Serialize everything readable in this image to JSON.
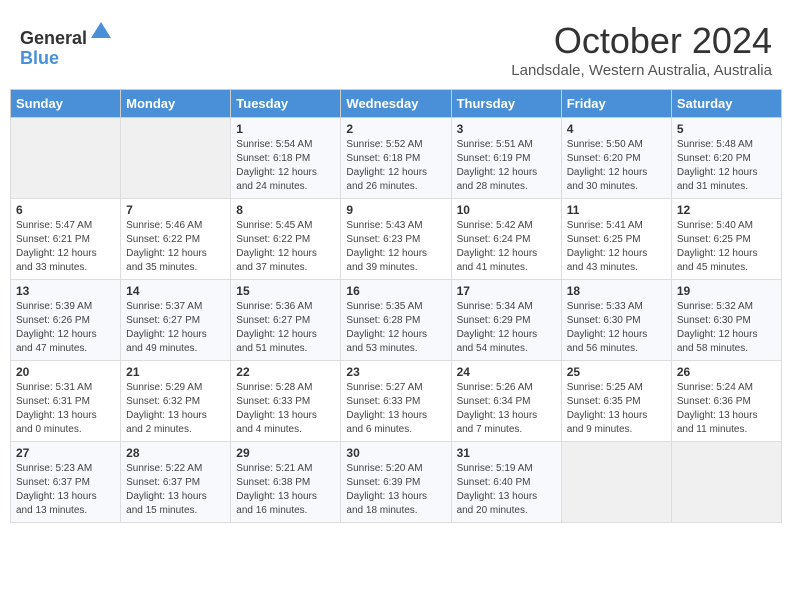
{
  "header": {
    "logo_line1": "General",
    "logo_line2": "Blue",
    "title": "October 2024",
    "subtitle": "Landsdale, Western Australia, Australia"
  },
  "days_of_week": [
    "Sunday",
    "Monday",
    "Tuesday",
    "Wednesday",
    "Thursday",
    "Friday",
    "Saturday"
  ],
  "weeks": [
    [
      {
        "day": "",
        "info": ""
      },
      {
        "day": "",
        "info": ""
      },
      {
        "day": "1",
        "info": "Sunrise: 5:54 AM\nSunset: 6:18 PM\nDaylight: 12 hours and 24 minutes."
      },
      {
        "day": "2",
        "info": "Sunrise: 5:52 AM\nSunset: 6:18 PM\nDaylight: 12 hours and 26 minutes."
      },
      {
        "day": "3",
        "info": "Sunrise: 5:51 AM\nSunset: 6:19 PM\nDaylight: 12 hours and 28 minutes."
      },
      {
        "day": "4",
        "info": "Sunrise: 5:50 AM\nSunset: 6:20 PM\nDaylight: 12 hours and 30 minutes."
      },
      {
        "day": "5",
        "info": "Sunrise: 5:48 AM\nSunset: 6:20 PM\nDaylight: 12 hours and 31 minutes."
      }
    ],
    [
      {
        "day": "6",
        "info": "Sunrise: 5:47 AM\nSunset: 6:21 PM\nDaylight: 12 hours and 33 minutes."
      },
      {
        "day": "7",
        "info": "Sunrise: 5:46 AM\nSunset: 6:22 PM\nDaylight: 12 hours and 35 minutes."
      },
      {
        "day": "8",
        "info": "Sunrise: 5:45 AM\nSunset: 6:22 PM\nDaylight: 12 hours and 37 minutes."
      },
      {
        "day": "9",
        "info": "Sunrise: 5:43 AM\nSunset: 6:23 PM\nDaylight: 12 hours and 39 minutes."
      },
      {
        "day": "10",
        "info": "Sunrise: 5:42 AM\nSunset: 6:24 PM\nDaylight: 12 hours and 41 minutes."
      },
      {
        "day": "11",
        "info": "Sunrise: 5:41 AM\nSunset: 6:25 PM\nDaylight: 12 hours and 43 minutes."
      },
      {
        "day": "12",
        "info": "Sunrise: 5:40 AM\nSunset: 6:25 PM\nDaylight: 12 hours and 45 minutes."
      }
    ],
    [
      {
        "day": "13",
        "info": "Sunrise: 5:39 AM\nSunset: 6:26 PM\nDaylight: 12 hours and 47 minutes."
      },
      {
        "day": "14",
        "info": "Sunrise: 5:37 AM\nSunset: 6:27 PM\nDaylight: 12 hours and 49 minutes."
      },
      {
        "day": "15",
        "info": "Sunrise: 5:36 AM\nSunset: 6:27 PM\nDaylight: 12 hours and 51 minutes."
      },
      {
        "day": "16",
        "info": "Sunrise: 5:35 AM\nSunset: 6:28 PM\nDaylight: 12 hours and 53 minutes."
      },
      {
        "day": "17",
        "info": "Sunrise: 5:34 AM\nSunset: 6:29 PM\nDaylight: 12 hours and 54 minutes."
      },
      {
        "day": "18",
        "info": "Sunrise: 5:33 AM\nSunset: 6:30 PM\nDaylight: 12 hours and 56 minutes."
      },
      {
        "day": "19",
        "info": "Sunrise: 5:32 AM\nSunset: 6:30 PM\nDaylight: 12 hours and 58 minutes."
      }
    ],
    [
      {
        "day": "20",
        "info": "Sunrise: 5:31 AM\nSunset: 6:31 PM\nDaylight: 13 hours and 0 minutes."
      },
      {
        "day": "21",
        "info": "Sunrise: 5:29 AM\nSunset: 6:32 PM\nDaylight: 13 hours and 2 minutes."
      },
      {
        "day": "22",
        "info": "Sunrise: 5:28 AM\nSunset: 6:33 PM\nDaylight: 13 hours and 4 minutes."
      },
      {
        "day": "23",
        "info": "Sunrise: 5:27 AM\nSunset: 6:33 PM\nDaylight: 13 hours and 6 minutes."
      },
      {
        "day": "24",
        "info": "Sunrise: 5:26 AM\nSunset: 6:34 PM\nDaylight: 13 hours and 7 minutes."
      },
      {
        "day": "25",
        "info": "Sunrise: 5:25 AM\nSunset: 6:35 PM\nDaylight: 13 hours and 9 minutes."
      },
      {
        "day": "26",
        "info": "Sunrise: 5:24 AM\nSunset: 6:36 PM\nDaylight: 13 hours and 11 minutes."
      }
    ],
    [
      {
        "day": "27",
        "info": "Sunrise: 5:23 AM\nSunset: 6:37 PM\nDaylight: 13 hours and 13 minutes."
      },
      {
        "day": "28",
        "info": "Sunrise: 5:22 AM\nSunset: 6:37 PM\nDaylight: 13 hours and 15 minutes."
      },
      {
        "day": "29",
        "info": "Sunrise: 5:21 AM\nSunset: 6:38 PM\nDaylight: 13 hours and 16 minutes."
      },
      {
        "day": "30",
        "info": "Sunrise: 5:20 AM\nSunset: 6:39 PM\nDaylight: 13 hours and 18 minutes."
      },
      {
        "day": "31",
        "info": "Sunrise: 5:19 AM\nSunset: 6:40 PM\nDaylight: 13 hours and 20 minutes."
      },
      {
        "day": "",
        "info": ""
      },
      {
        "day": "",
        "info": ""
      }
    ]
  ]
}
